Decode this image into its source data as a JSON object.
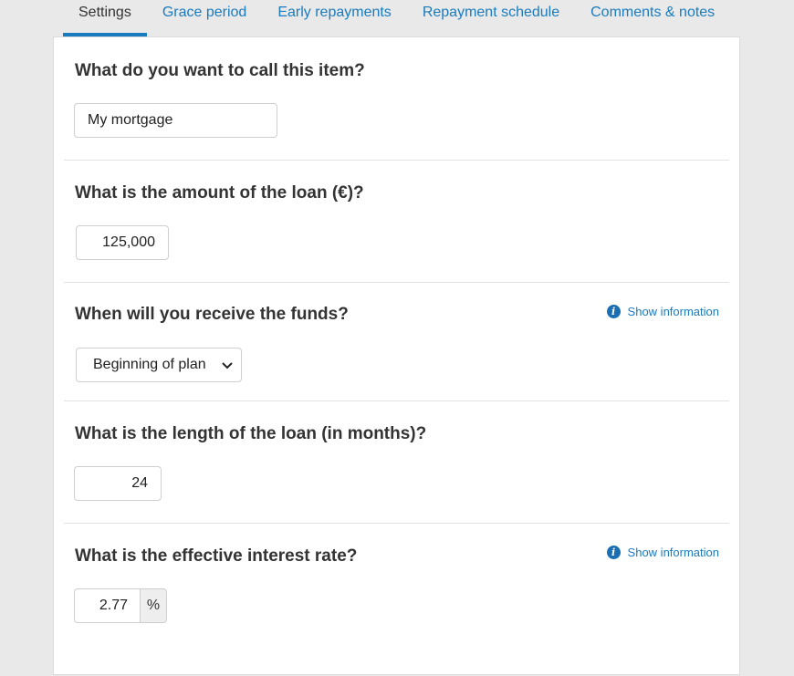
{
  "tabs": [
    {
      "label": "Settings",
      "active": true
    },
    {
      "label": "Grace period",
      "active": false
    },
    {
      "label": "Early repayments",
      "active": false
    },
    {
      "label": "Repayment schedule",
      "active": false
    },
    {
      "label": "Comments & notes",
      "active": false
    }
  ],
  "sections": {
    "name": {
      "question": "What do you want to call this item?",
      "value": "My mortgage"
    },
    "amount": {
      "question": "What is the amount of the loan (€)?",
      "value": "125,000"
    },
    "funds": {
      "question": "When will you receive the funds?",
      "selected": "Beginning of plan",
      "info_label": "Show information",
      "info_icon": "info-circle-icon"
    },
    "length": {
      "question": "What is the length of the loan (in months)?",
      "value": "24"
    },
    "rate": {
      "question": "What is the effective interest rate?",
      "value": "2.77",
      "unit": "%",
      "info_label": "Show information",
      "info_icon": "info-circle-icon"
    }
  },
  "colors": {
    "accent": "#1a7bbf",
    "background": "#e9e9e9",
    "panel": "#ffffff"
  }
}
